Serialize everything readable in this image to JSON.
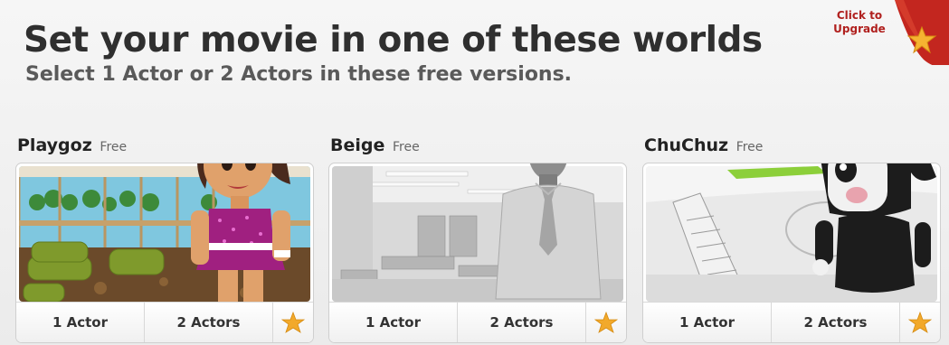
{
  "header": {
    "title": "Set your movie in one of these worlds",
    "subtitle": "Select 1 Actor or 2 Actors in these free versions."
  },
  "upgrade": {
    "line1": "Click to",
    "line2": "Upgrade"
  },
  "worlds": [
    {
      "name": "Playgoz",
      "badge": "Free",
      "actor1": "1 Actor",
      "actor2": "2 Actors"
    },
    {
      "name": "Beige",
      "badge": "Free",
      "actor1": "1 Actor",
      "actor2": "2 Actors"
    },
    {
      "name": "ChuChuz",
      "badge": "Free",
      "actor1": "1 Actor",
      "actor2": "2 Actors"
    }
  ],
  "colors": {
    "accent_star": "#f2a92b",
    "upgrade_red": "#c3261f"
  },
  "icons": {
    "favorite": "star-icon"
  }
}
